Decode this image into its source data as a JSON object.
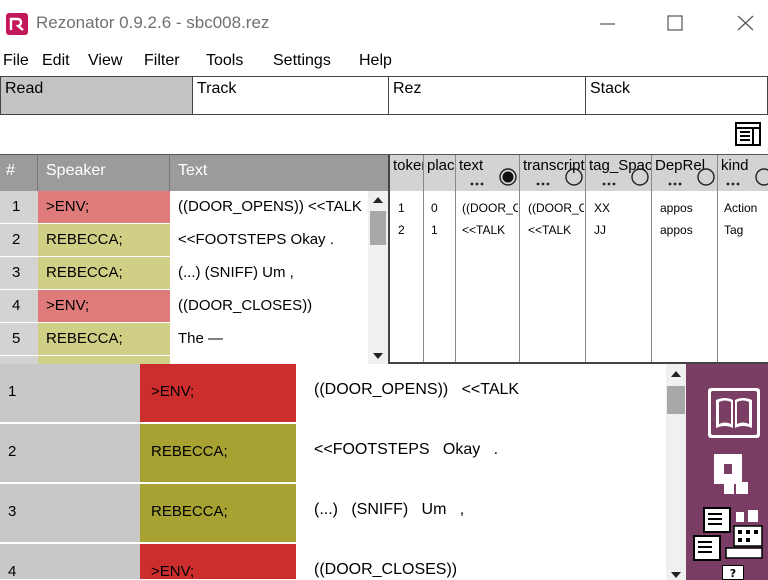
{
  "window": {
    "title": "Rezonator 0.9.2.6 - sbc008.rez"
  },
  "menu": [
    "File",
    "Edit",
    "View",
    "Filter",
    "Tools",
    "Settings",
    "Help"
  ],
  "mode_tabs": [
    {
      "label": "Read",
      "active": true
    },
    {
      "label": "Track",
      "active": false
    },
    {
      "label": "Rez",
      "active": false
    },
    {
      "label": "Stack",
      "active": false
    }
  ],
  "left_grid": {
    "headers": [
      "#",
      "Speaker",
      "Text"
    ],
    "rows": [
      {
        "num": "1",
        "speaker": ">ENV;",
        "text": "((DOOR_OPENS)) <<TALK",
        "color": "#e07b7b"
      },
      {
        "num": "2",
        "speaker": "REBECCA;",
        "text": "<<FOOTSTEPS Okay .",
        "color": "#cfcf85"
      },
      {
        "num": "3",
        "speaker": "REBECCA;",
        "text": "(...) (SNIFF) Um ,",
        "color": "#cfcf85"
      },
      {
        "num": "4",
        "speaker": ">ENV;",
        "text": "((DOOR_CLOSES))",
        "color": "#e07b7b"
      },
      {
        "num": "5",
        "speaker": "REBECCA;",
        "text": "The —",
        "color": "#cfcf85"
      }
    ]
  },
  "right_grid": {
    "headers": [
      "token",
      "place",
      "text",
      "transcript",
      "tag_Spacy",
      "DepRel",
      "kind"
    ],
    "rows": [
      [
        "1",
        "0",
        "((DOOR_OPENS))",
        "((DOOR_OPENS))",
        "XX",
        "appos",
        "Action"
      ],
      [
        "2",
        "1",
        "<<TALK",
        "<<TALK",
        "JJ",
        "appos",
        "Tag"
      ]
    ]
  },
  "bottom_grid": {
    "rows": [
      {
        "num": "1",
        "speaker": ">ENV;",
        "text": "((DOOR_OPENS))   <<TALK",
        "color": "#cc2e2e"
      },
      {
        "num": "2",
        "speaker": "REBECCA;",
        "text": "<<FOOTSTEPS   Okay   .",
        "color": "#a8a232"
      },
      {
        "num": "3",
        "speaker": "REBECCA;",
        "text": "(...)   (SNIFF)   Um   ,",
        "color": "#a8a232"
      },
      {
        "num": "4",
        "speaker": ">ENV;",
        "text": "((DOOR_CLOSES))",
        "color": "#cc2e2e"
      }
    ]
  },
  "side_panel": {
    "help_label": "?"
  },
  "colors": {
    "accent": "#7a3d63",
    "env_light": "#e07b7b",
    "speaker_light": "#cfcf85",
    "env_dark": "#cc2e2e",
    "speaker_dark": "#a8a232"
  }
}
